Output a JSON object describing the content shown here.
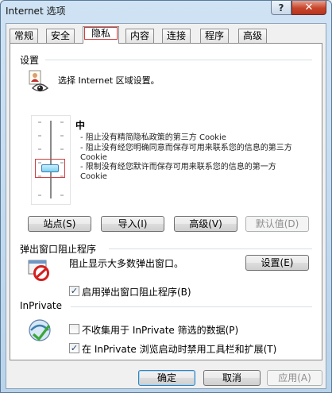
{
  "window": {
    "title": "Internet 选项",
    "help": "?",
    "close": "✕"
  },
  "tabs": [
    {
      "label": "常规"
    },
    {
      "label": "安全"
    },
    {
      "label": "隐私"
    },
    {
      "label": "内容"
    },
    {
      "label": "连接"
    },
    {
      "label": "程序"
    },
    {
      "label": "高级"
    }
  ],
  "active_tab": "隐私",
  "settings": {
    "title": "设置",
    "description": "选择 Internet 区域设置。",
    "level": "中",
    "level_slider_position": "middle",
    "bullets": [
      "- 阻止没有精简隐私政策的第三方 Cookie",
      "- 阻止没有经您明确同意而保存可用来联系您的信息的第三方 Cookie",
      "- 限制没有经您默许而保存可用来联系您的信息的第一方 Cookie"
    ],
    "buttons": {
      "sites": "站点(S)",
      "import": "导入(I)",
      "advanced": "高级(V)",
      "default": "默认值(D)"
    }
  },
  "popup": {
    "title": "弹出窗口阻止程序",
    "description": "阻止显示大多数弹出窗口。",
    "settings_button": "设置(E)",
    "enable_label": "启用弹出窗口阻止程序(B)",
    "enable_checked": true
  },
  "inprivate": {
    "title": "InPrivate",
    "no_collect_label": "不收集用于 InPrivate 筛选的数据(P)",
    "no_collect_checked": false,
    "disable_toolbars_label": "在 InPrivate 浏览启动时禁用工具栏和扩展(T)",
    "disable_toolbars_checked": true
  },
  "footer": {
    "ok": "确定",
    "cancel": "取消",
    "apply": "应用(A)"
  },
  "colors": {
    "active_tab_outline": "#cc3b3b",
    "slider_thumb": "#7fd0ef",
    "close_button": "#c6442a"
  }
}
